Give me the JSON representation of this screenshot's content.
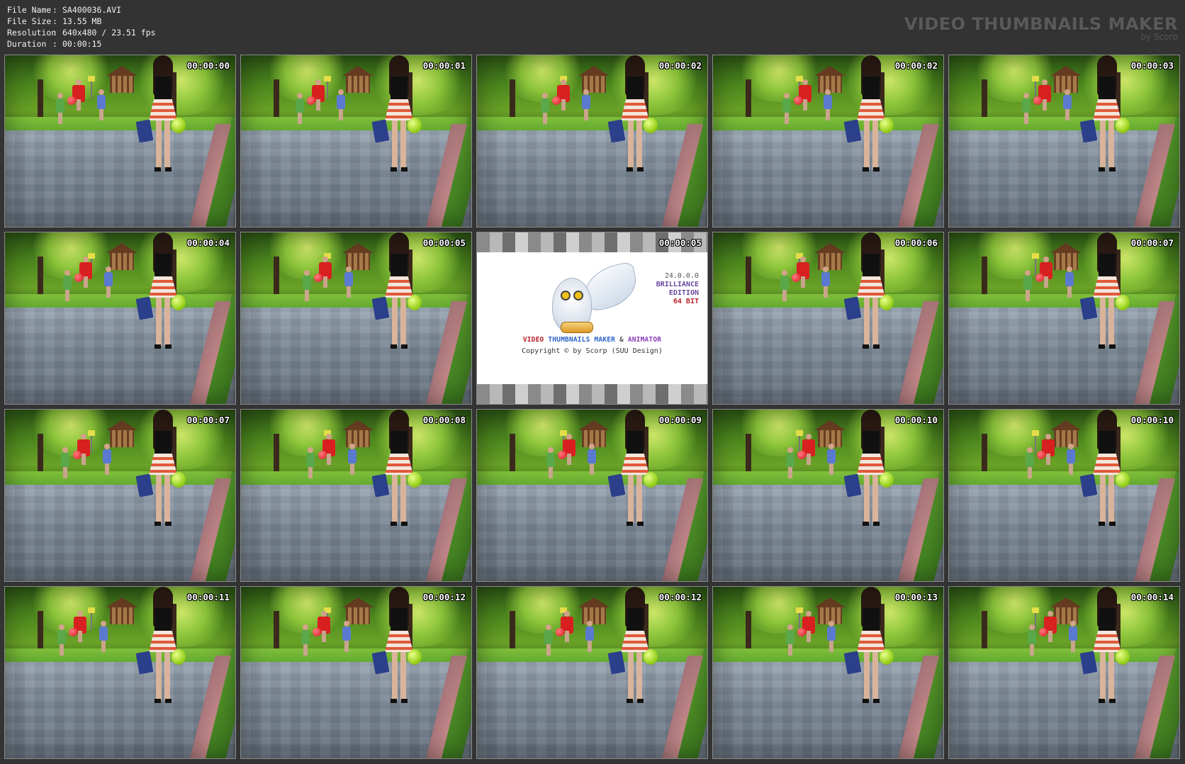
{
  "meta": {
    "rows": [
      {
        "key": "File Name",
        "sep": ":",
        "value": "SA400036.AVI"
      },
      {
        "key": "File Size",
        "sep": ":",
        "value": "13.55 MB"
      },
      {
        "key": "Resolution",
        "sep": ":",
        "value": "640x480 / 23.51 fps"
      },
      {
        "key": "Duration",
        "sep": ":",
        "value": "00:00:15"
      }
    ]
  },
  "brand": {
    "title": "VIDEO THUMBNAILS MAKER",
    "subtitle": "by Scorp"
  },
  "thumbnails": [
    {
      "time": "00:00:00"
    },
    {
      "time": "00:00:01"
    },
    {
      "time": "00:00:02"
    },
    {
      "time": "00:00:02"
    },
    {
      "time": "00:00:03"
    },
    {
      "time": "00:00:04"
    },
    {
      "time": "00:00:05"
    },
    {
      "time": "00:00:05",
      "splash": true
    },
    {
      "time": "00:00:06"
    },
    {
      "time": "00:00:07"
    },
    {
      "time": "00:00:07"
    },
    {
      "time": "00:00:08"
    },
    {
      "time": "00:00:09"
    },
    {
      "time": "00:00:10"
    },
    {
      "time": "00:00:10"
    },
    {
      "time": "00:00:11"
    },
    {
      "time": "00:00:12"
    },
    {
      "time": "00:00:12"
    },
    {
      "time": "00:00:13"
    },
    {
      "time": "00:00:14"
    }
  ],
  "splash": {
    "version": "24.0.0.0",
    "edition_line1": "BRILLIANCE",
    "edition_line2": "EDITION",
    "bits": "64 BIT",
    "product_part1": "VIDEO ",
    "product_part2": "THUMBNAILS MAKER",
    "product_part3": " & ",
    "product_part4": "ANIMATOR",
    "copyright": "Copyright © by Scorp (SUU Design)"
  }
}
